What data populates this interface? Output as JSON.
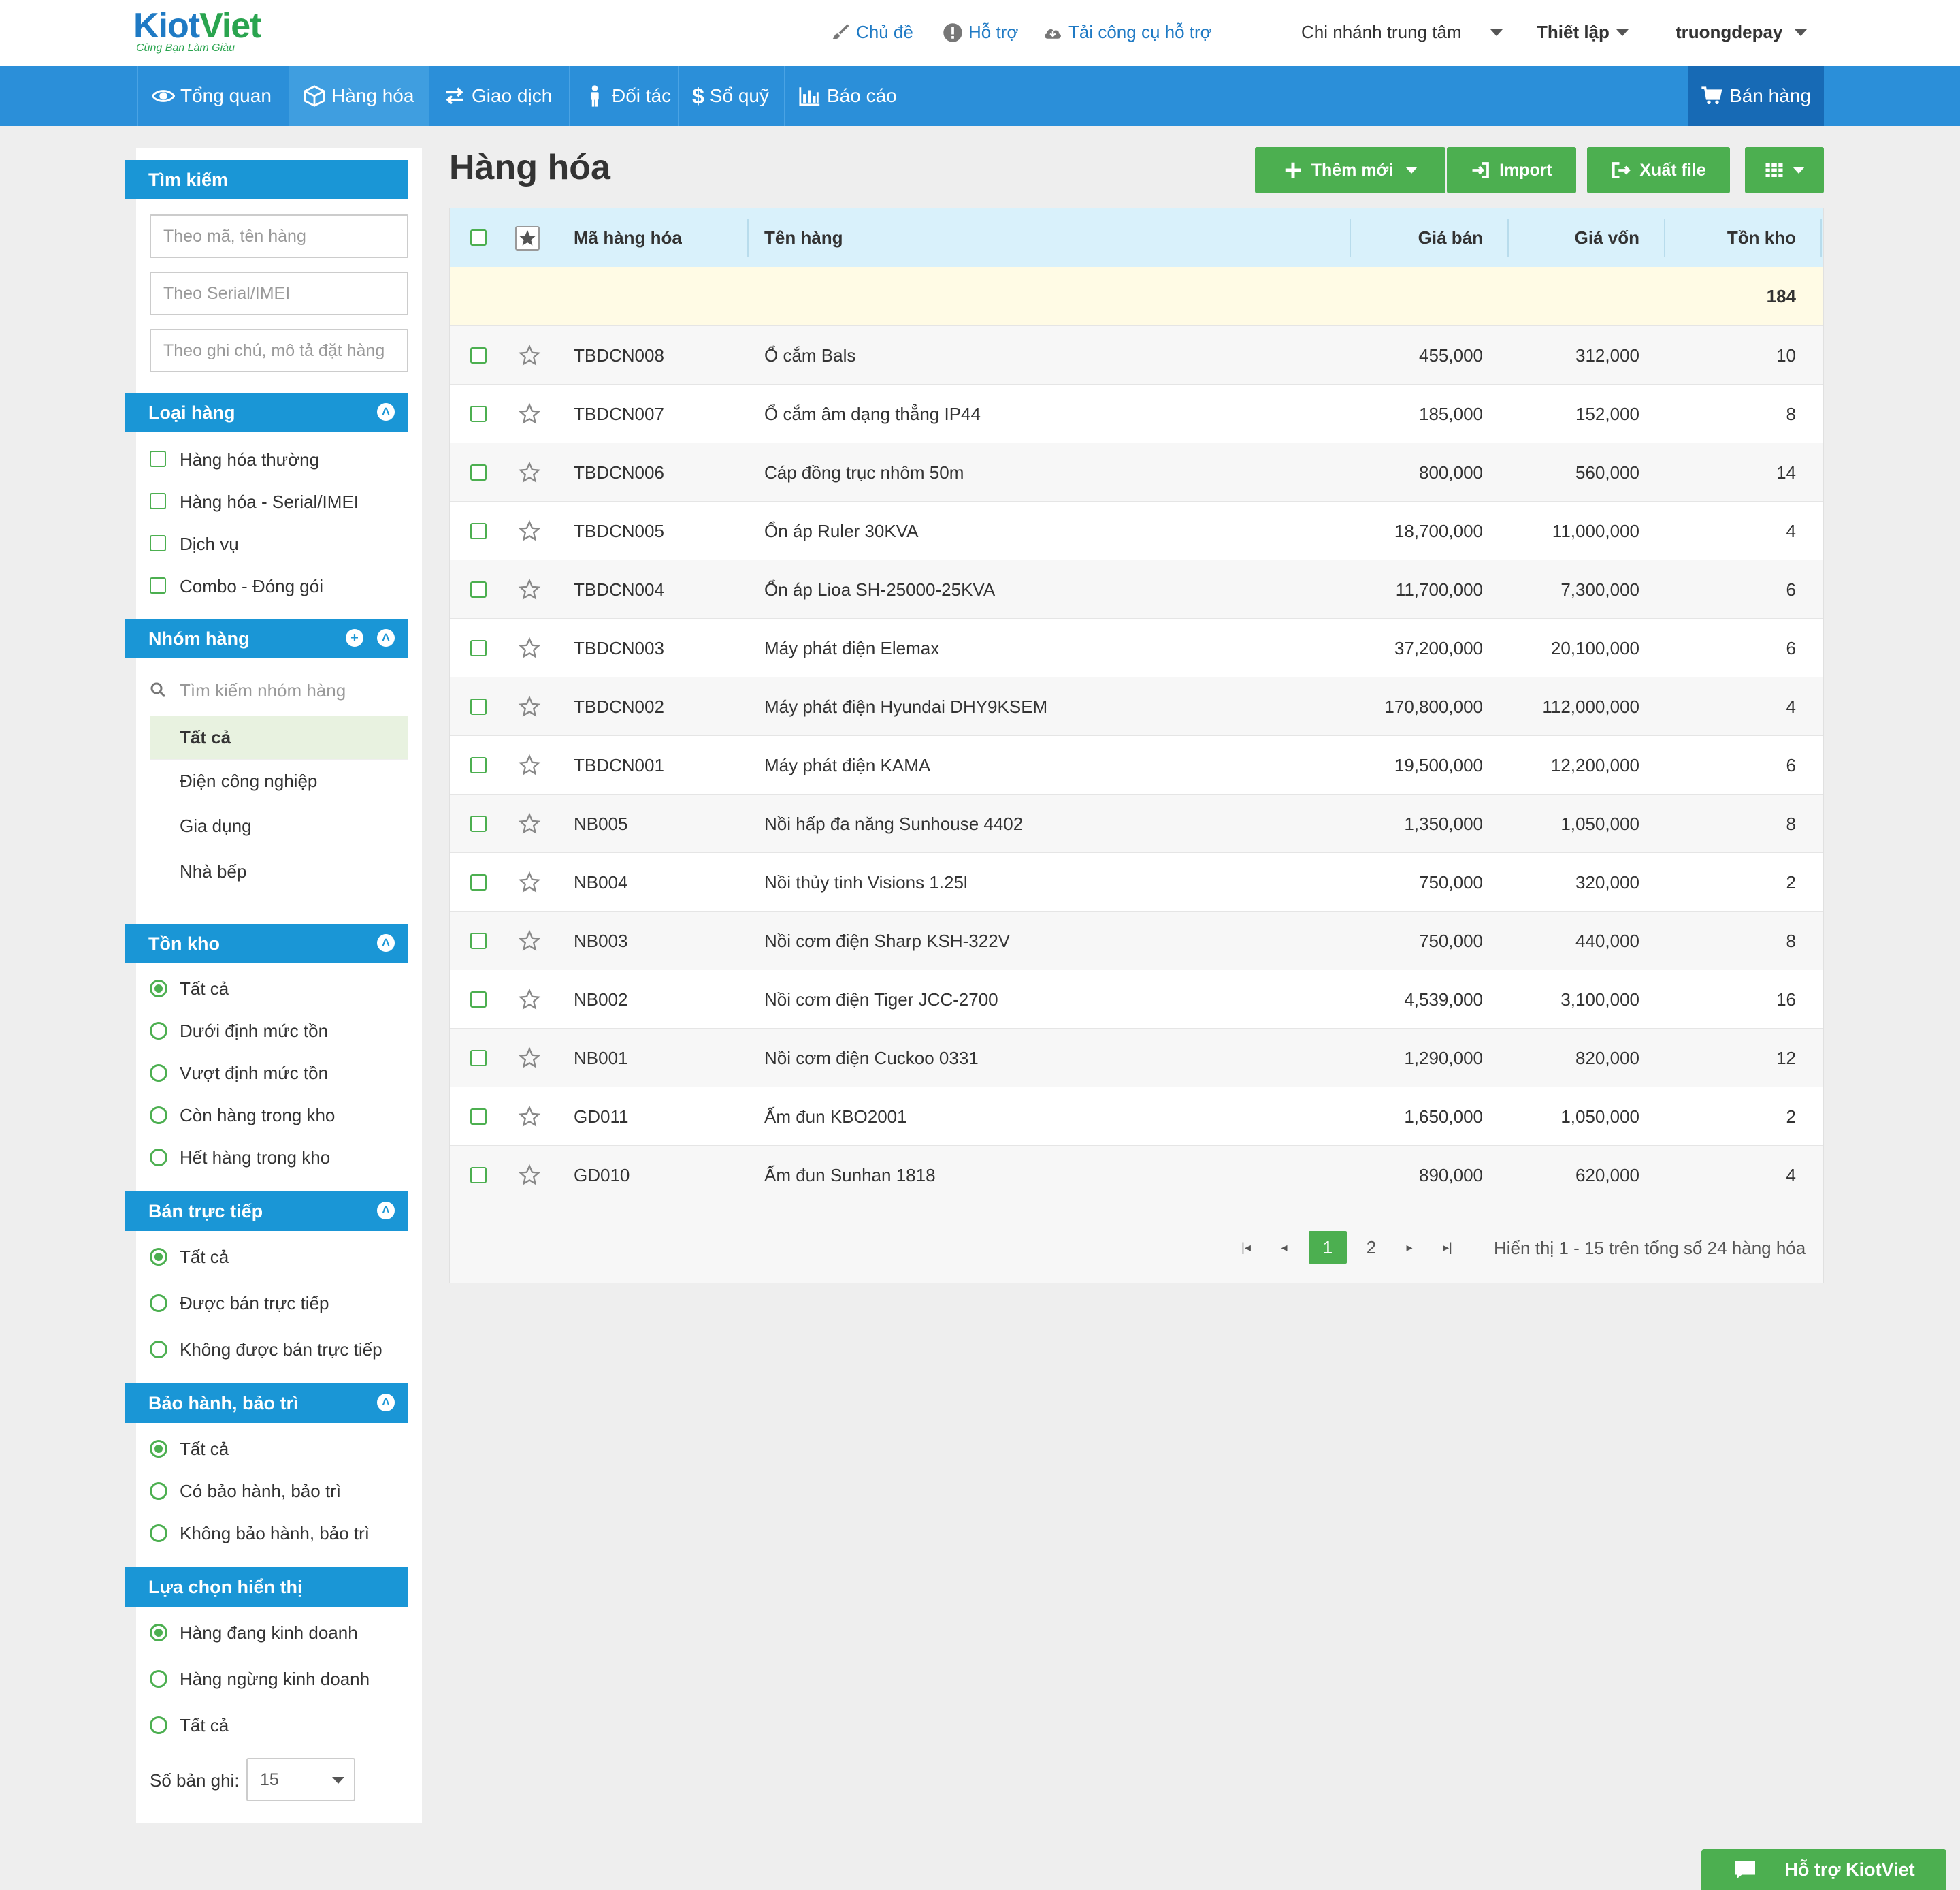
{
  "header": {
    "logo_main_a": "Kiot",
    "logo_main_b": "Viet",
    "logo_sub": "Cùng Bạn Làm Giàu",
    "links": [
      "Chủ đề",
      "Hỗ trợ",
      "Tải công cụ hỗ trợ"
    ],
    "branch": "Chi nhánh trung tâm",
    "settings": "Thiết lập",
    "user": "truongdepay"
  },
  "nav": {
    "items": [
      "Tổng quan",
      "Hàng hóa",
      "Giao dịch",
      "Đối tác",
      "Sổ quỹ",
      "Báo cáo"
    ],
    "active": "Hàng hóa",
    "sell": "Bán hàng"
  },
  "sidebar": {
    "search": {
      "title": "Tìm kiếm",
      "placeholders": [
        "Theo mã, tên hàng",
        "Theo Serial/IMEI",
        "Theo ghi chú, mô tả đặt hàng"
      ]
    },
    "type": {
      "title": "Loại hàng",
      "options": [
        "Hàng hóa thường",
        "Hàng hóa - Serial/IMEI",
        "Dịch vụ",
        "Combo - Đóng gói"
      ]
    },
    "group": {
      "title": "Nhóm hàng",
      "search_placeholder": "Tìm kiếm nhóm hàng",
      "items": [
        "Tất cả",
        "Điện công nghiệp",
        "Gia dụng",
        "Nhà bếp"
      ],
      "selected": "Tất cả"
    },
    "stock": {
      "title": "Tồn kho",
      "options": [
        "Tất cả",
        "Dưới định mức tồn",
        "Vượt định mức tồn",
        "Còn hàng trong kho",
        "Hết hàng trong kho"
      ],
      "selected": "Tất cả"
    },
    "direct_sale": {
      "title": "Bán trực tiếp",
      "options": [
        "Tất cả",
        "Được bán trực tiếp",
        "Không được bán trực tiếp"
      ],
      "selected": "Tất cả"
    },
    "warranty": {
      "title": "Bảo hành, bảo trì",
      "options": [
        "Tất cả",
        "Có bảo hành, bảo trì",
        "Không bảo hành, bảo trì"
      ],
      "selected": "Tất cả"
    },
    "display": {
      "title": "Lựa chọn hiển thị",
      "options": [
        "Hàng đang kinh doanh",
        "Hàng ngừng kinh doanh",
        "Tất cả"
      ],
      "selected": "Hàng đang kinh doanh"
    },
    "records_label": "Số bản ghi:",
    "records_value": "15"
  },
  "main": {
    "title": "Hàng hóa",
    "buttons": {
      "add": "Thêm mới",
      "import": "Import",
      "export": "Xuất file"
    },
    "columns": {
      "code": "Mã hàng hóa",
      "name": "Tên hàng",
      "price": "Giá bán",
      "cost": "Giá vốn",
      "stock": "Tồn kho"
    },
    "total_stock": "184",
    "rows": [
      {
        "code": "TBDCN008",
        "name": "Ổ cắm Bals",
        "price": "455,000",
        "cost": "312,000",
        "stock": "10"
      },
      {
        "code": "TBDCN007",
        "name": "Ổ cắm âm dạng thẳng IP44",
        "price": "185,000",
        "cost": "152,000",
        "stock": "8"
      },
      {
        "code": "TBDCN006",
        "name": "Cáp đồng trục nhôm 50m",
        "price": "800,000",
        "cost": "560,000",
        "stock": "14"
      },
      {
        "code": "TBDCN005",
        "name": "Ổn áp Ruler 30KVA",
        "price": "18,700,000",
        "cost": "11,000,000",
        "stock": "4"
      },
      {
        "code": "TBDCN004",
        "name": "Ổn áp Lioa SH-25000-25KVA",
        "price": "11,700,000",
        "cost": "7,300,000",
        "stock": "6"
      },
      {
        "code": "TBDCN003",
        "name": "Máy phát điện Elemax",
        "price": "37,200,000",
        "cost": "20,100,000",
        "stock": "6"
      },
      {
        "code": "TBDCN002",
        "name": "Máy phát điện Hyundai DHY9KSEM",
        "price": "170,800,000",
        "cost": "112,000,000",
        "stock": "4"
      },
      {
        "code": "TBDCN001",
        "name": "Máy phát điện KAMA",
        "price": "19,500,000",
        "cost": "12,200,000",
        "stock": "6"
      },
      {
        "code": "NB005",
        "name": "Nồi hấp đa năng Sunhouse 4402",
        "price": "1,350,000",
        "cost": "1,050,000",
        "stock": "8"
      },
      {
        "code": "NB004",
        "name": "Nồi thủy tinh Visions 1.25l",
        "price": "750,000",
        "cost": "320,000",
        "stock": "2"
      },
      {
        "code": "NB003",
        "name": "Nồi cơm điện Sharp KSH-322V",
        "price": "750,000",
        "cost": "440,000",
        "stock": "8"
      },
      {
        "code": "NB002",
        "name": "Nồi cơm điện Tiger JCC-2700",
        "price": "4,539,000",
        "cost": "3,100,000",
        "stock": "16"
      },
      {
        "code": "NB001",
        "name": "Nồi cơm điện Cuckoo 0331",
        "price": "1,290,000",
        "cost": "820,000",
        "stock": "12"
      },
      {
        "code": "GD011",
        "name": "Ấm đun KBO2001",
        "price": "1,650,000",
        "cost": "1,050,000",
        "stock": "2"
      },
      {
        "code": "GD010",
        "name": "Ấm đun Sunhan 1818",
        "price": "890,000",
        "cost": "620,000",
        "stock": "4"
      }
    ],
    "pagination": {
      "pages": [
        "1",
        "2"
      ],
      "current": "1",
      "summary": "Hiển thị 1 - 15 trên tổng số 24 hàng hóa"
    }
  },
  "support_button": "Hỗ trợ KiotViet",
  "colors": {
    "brand_blue": "#2b8fd9",
    "sidebar_head": "#1a96d6",
    "green": "#4caf50",
    "table_head": "#d9f1fb"
  }
}
